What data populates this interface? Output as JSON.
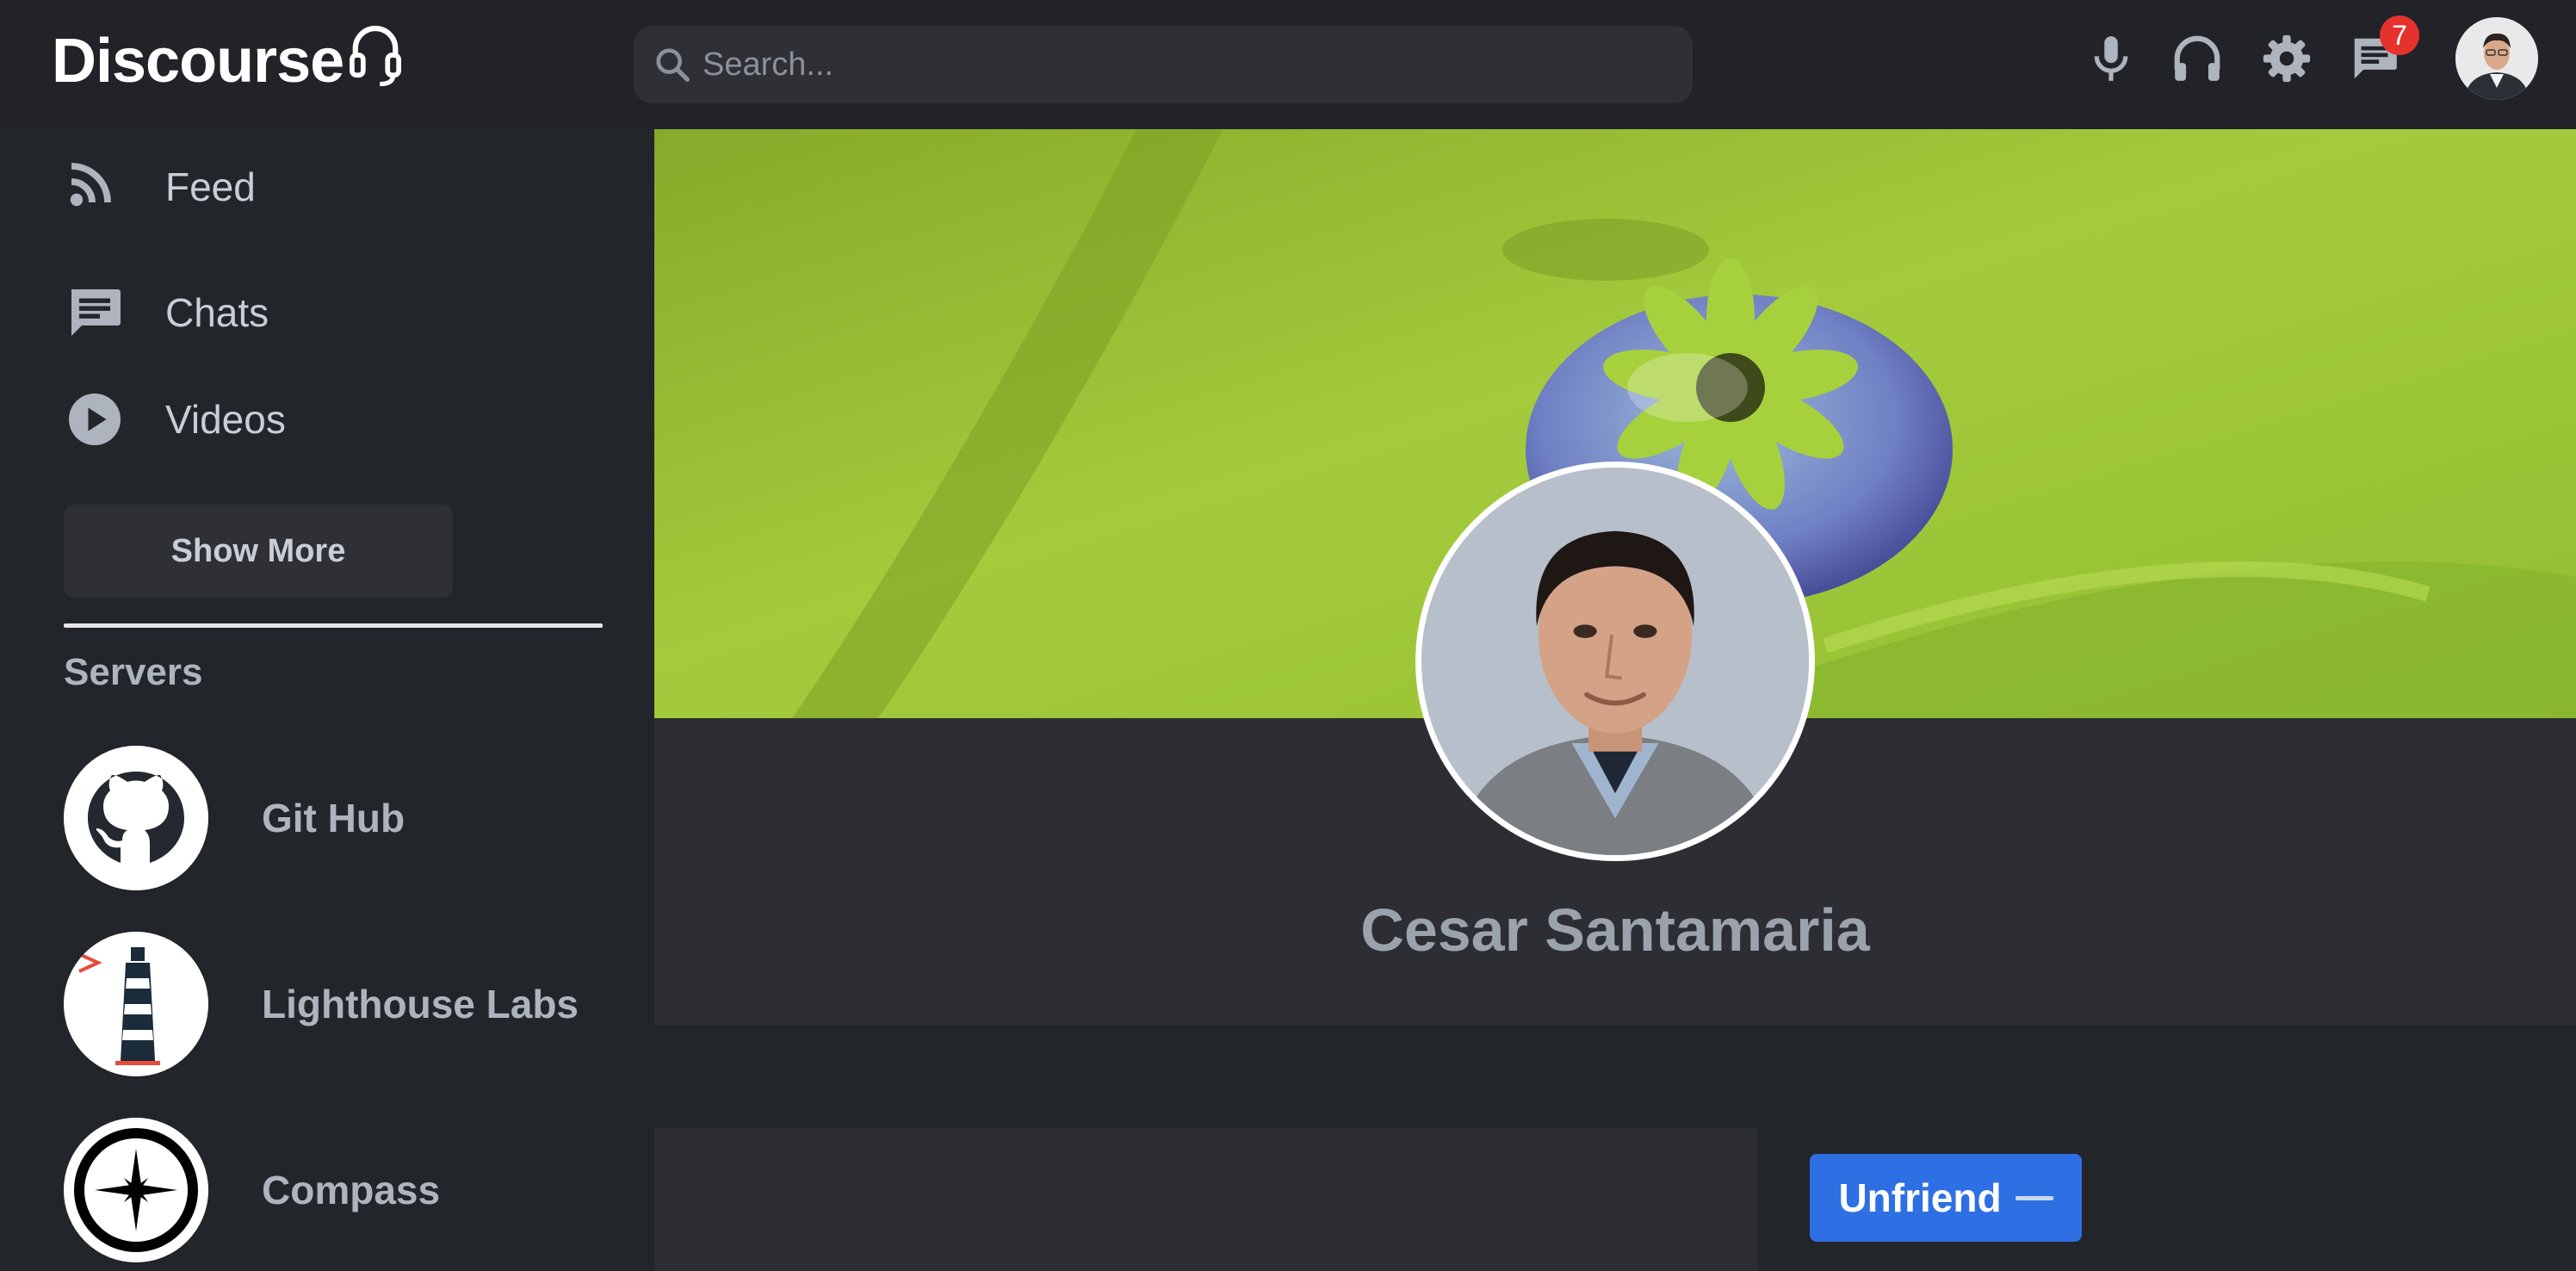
{
  "header": {
    "brand": "Discourse",
    "brand_icon": "headset-icon",
    "search_placeholder": "Search...",
    "icons": [
      "microphone-icon",
      "headphones-icon",
      "gear-icon",
      "chat-icon",
      "user-avatar"
    ],
    "notification_count": "7",
    "notification_badge_color": "#e5322d"
  },
  "sidebar": {
    "nav": [
      {
        "label": "Feed",
        "icon": "rss-icon"
      },
      {
        "label": "Chats",
        "icon": "chat-icon"
      },
      {
        "label": "Videos",
        "icon": "play-circle-icon"
      }
    ],
    "show_more": "Show More",
    "servers_heading": "Servers",
    "servers": [
      {
        "name": "Git Hub",
        "icon": "github-icon"
      },
      {
        "name": "Lighthouse Labs",
        "icon": "lighthouse-icon"
      },
      {
        "name": "Compass",
        "icon": "compass-icon"
      }
    ]
  },
  "profile": {
    "name": "Cesar Santamaria",
    "unfriend_label": "Unfriend",
    "unfriend_icon": "minus-icon"
  },
  "colors": {
    "background": "#22252a",
    "panel": "#2c2e33",
    "accent": "#2f6fe4",
    "cover_green": "#9fc93a"
  }
}
